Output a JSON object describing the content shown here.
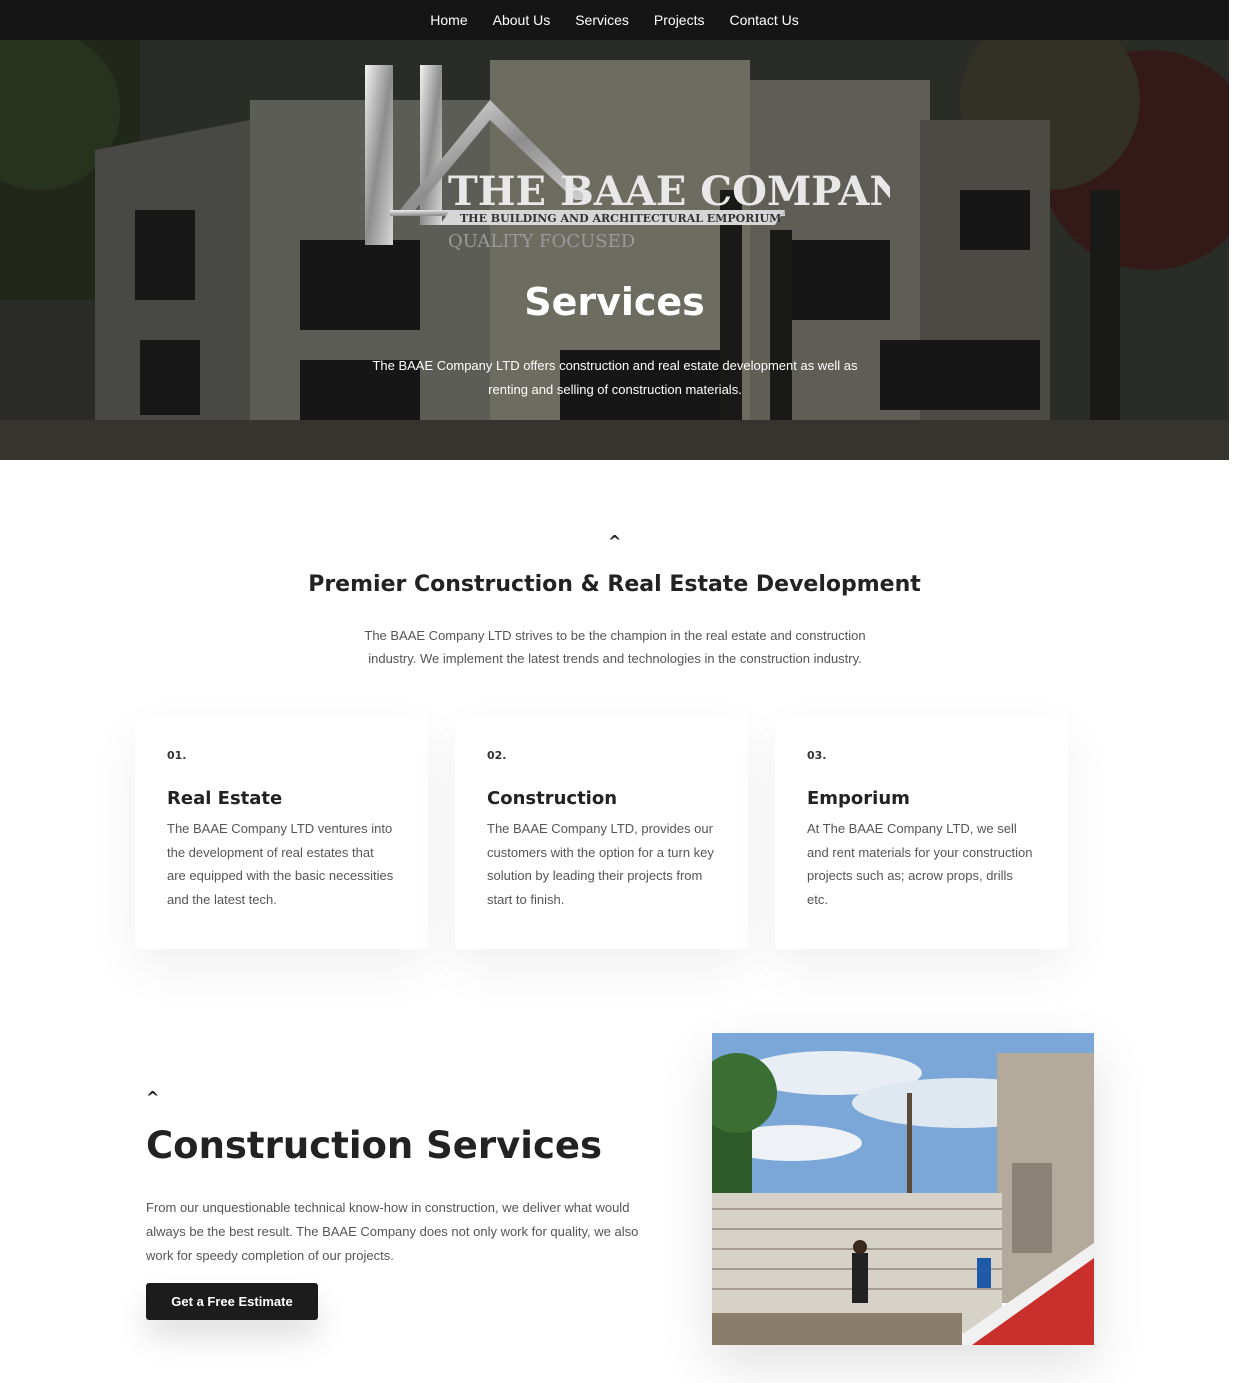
{
  "nav": {
    "items": [
      {
        "label": "Home"
      },
      {
        "label": "About Us"
      },
      {
        "label": "Services"
      },
      {
        "label": "Projects"
      },
      {
        "label": "Contact Us"
      }
    ]
  },
  "hero": {
    "logo": {
      "name": "THE BAAE COMPANY",
      "tagline": "THE BUILDING AND ARCHITECTURAL EMPORIUM",
      "motto": "QUALITY FOCUSED"
    },
    "title": "Services",
    "description": "The BAAE Company LTD offers construction and real estate development as well as renting and selling of construction materials."
  },
  "premier": {
    "caret": "^",
    "title": "Premier Construction & Real Estate Development",
    "description": "The BAAE Company LTD strives to be the champion in the real estate and construction industry. We implement the latest trends and technologies in the construction industry."
  },
  "cards": [
    {
      "number": "01.",
      "title": "Real Estate",
      "text": "The BAAE Company LTD ventures into the development of real estates that are equipped with the basic necessities and the latest tech."
    },
    {
      "number": "02.",
      "title": "Construction",
      "text": "The BAAE Company LTD, provides our customers with the option for a turn key solution by leading their projects from start to finish."
    },
    {
      "number": "03.",
      "title": "Emporium",
      "text": "At The BAAE Company LTD, we sell and rent materials for your construction projects such as; acrow props, drills etc."
    }
  ],
  "construction": {
    "caret": "^",
    "title": "Construction Services",
    "text": "From our unquestionable technical know-how in construction, we deliver what would always be the best result. The BAAE Company does not only work for quality, we also work for speedy completion of our projects.",
    "button_label": "Get a Free Estimate"
  },
  "colors": {
    "nav_bg": "#151515",
    "button_bg": "#1c1c1c",
    "text_dark": "#222222",
    "text_body": "#555555"
  }
}
